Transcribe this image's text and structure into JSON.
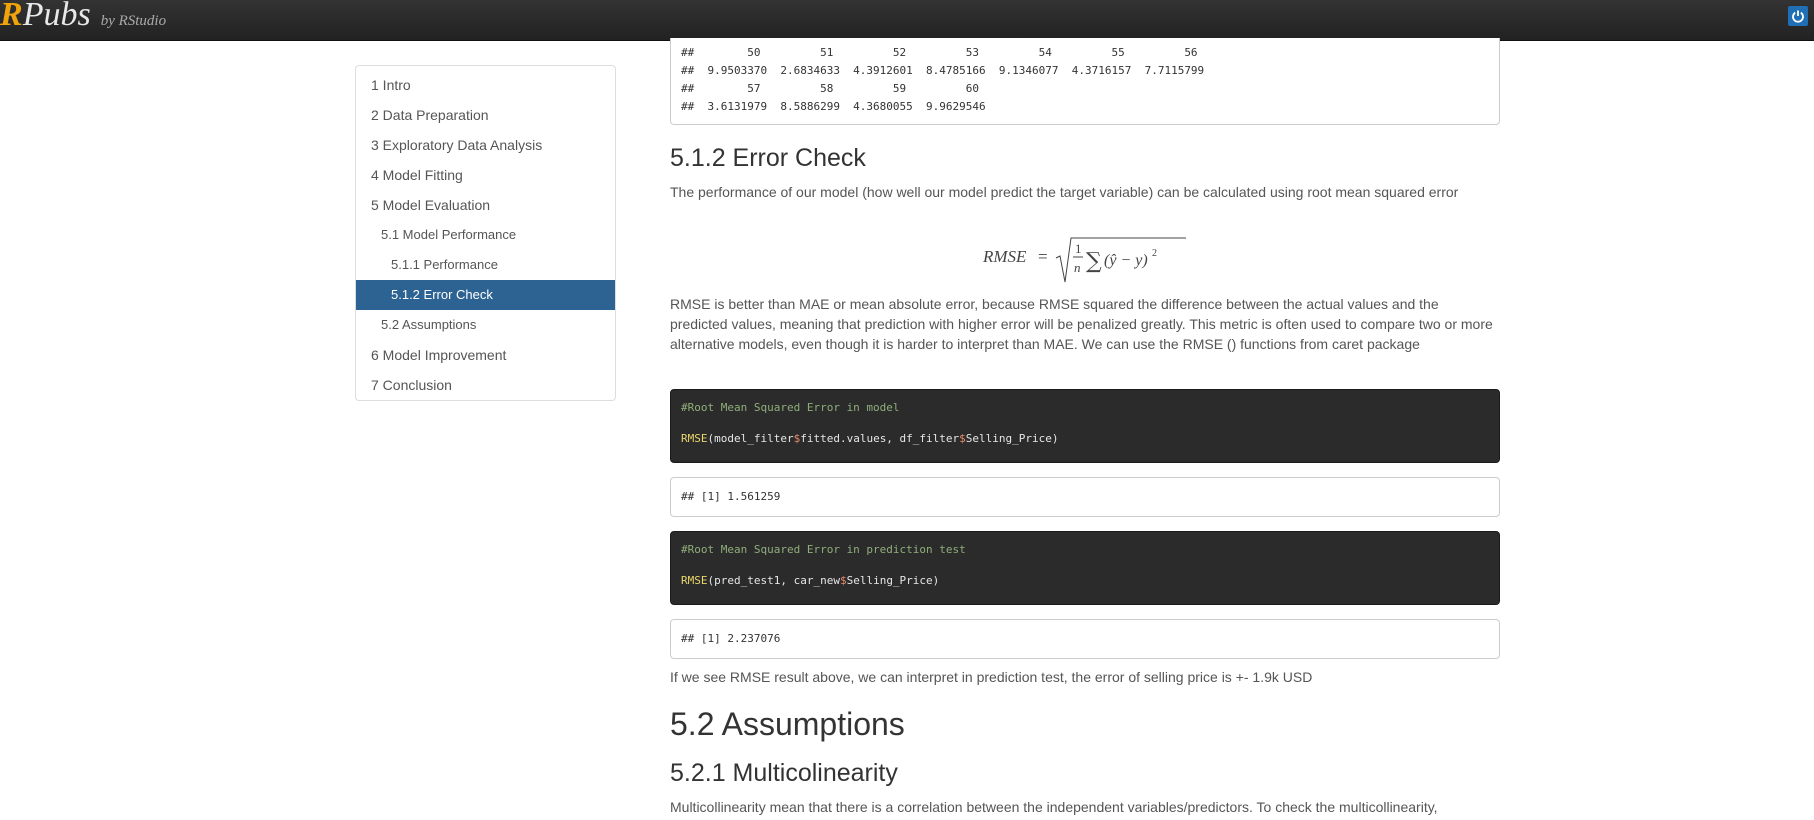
{
  "header": {
    "logo_r": "R",
    "logo_pubs": "Pubs",
    "logo_by": "by RStudio"
  },
  "toc": {
    "items": [
      {
        "label": "1 Intro",
        "level": 1
      },
      {
        "label": "2 Data Preparation",
        "level": 1
      },
      {
        "label": "3 Exploratory Data Analysis",
        "level": 1
      },
      {
        "label": "4 Model Fitting",
        "level": 1
      },
      {
        "label": "5 Model Evaluation",
        "level": 1
      },
      {
        "label": "5.1 Model Performance",
        "level": 2
      },
      {
        "label": "5.1.1 Performance",
        "level": 3
      },
      {
        "label": "5.1.2 Error Check",
        "level": 3,
        "active": true
      },
      {
        "label": "5.2 Assumptions",
        "level": 2
      },
      {
        "label": "6 Model Improvement",
        "level": 1
      },
      {
        "label": "7 Conclusion",
        "level": 1
      }
    ]
  },
  "output_top": {
    "lines": [
      "##        50         51         52         53         54         55         56",
      "##  9.9503370  2.6834633  4.3912601  8.4785166  9.1346077  4.3716157  7.7115799",
      "##        57         58         59         60",
      "##  3.6131979  8.5886299  4.3680055  9.9629546"
    ]
  },
  "section_error_check": {
    "heading": "5.1.2 Error Check",
    "intro": "The performance of our model (how well our model predict the target variable) can be calculated using root mean squared error",
    "formula_lhs": "RMSE",
    "explanation": "RMSE is better than MAE or mean absolute error, because RMSE squared the difference between the actual values and the predicted values, meaning that prediction with higher error will be penalized greatly. This metric is often used to compare two or more alternative models, even though it is harder to interpret than MAE. We can use the RMSE () functions from caret package"
  },
  "code1": {
    "comment": "#Root Mean Squared Error in model",
    "fn": "RMSE",
    "args_a": "(model_filter",
    "args_b": "fitted.values, df_filter",
    "args_c": "Selling_Price)"
  },
  "out1": "## [1] 1.561259",
  "code2": {
    "comment": "#Root Mean Squared Error in prediction test",
    "fn": "RMSE",
    "args_a": "(pred_test1, car_new",
    "args_b": "Selling_Price)"
  },
  "out2": "## [1] 2.237076",
  "interpretation": "If we see RMSE result above, we can interpret in prediction test, the error of selling price is +- 1.9k USD",
  "section_assumptions": {
    "heading": "5.2 Assumptions",
    "sub_heading": "5.2.1 Multicolinearity",
    "text": "Multicollinearity mean that there is a correlation between the independent variables/predictors. To check the multicollinearity,"
  },
  "colors": {
    "topbar": "#2b2b2b",
    "logo_accent": "#f0a30a",
    "toc_active": "#2c6393",
    "code_bg": "#2b2b2b",
    "code_comment": "#8fae7a",
    "code_fn": "#e9d66b",
    "code_dollar": "#e88b6f"
  },
  "icons": {
    "power": "power-icon"
  }
}
